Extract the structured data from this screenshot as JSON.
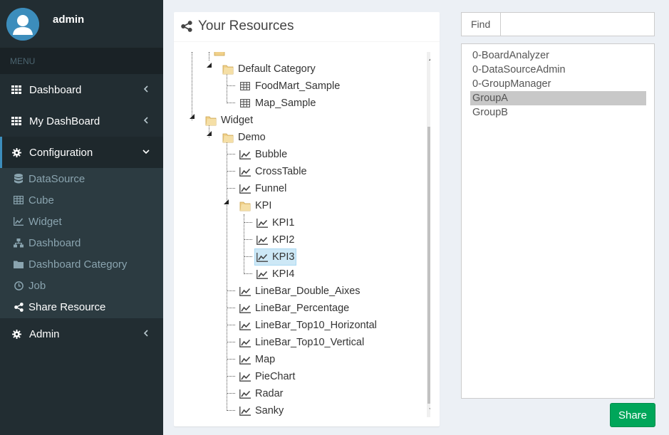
{
  "user": {
    "name": "admin"
  },
  "sidebar": {
    "menu_header": "MENU",
    "items": [
      {
        "label": "Dashboard",
        "icon": "grid-icon"
      },
      {
        "label": "My DashBoard",
        "icon": "grid-icon"
      },
      {
        "label": "Configuration",
        "icon": "gear-icon",
        "expanded": true
      },
      {
        "label": "Admin",
        "icon": "gear-icon"
      }
    ],
    "config_subitems": [
      {
        "label": "DataSource",
        "icon": "database-icon"
      },
      {
        "label": "Cube",
        "icon": "table-icon"
      },
      {
        "label": "Widget",
        "icon": "line-chart-icon"
      },
      {
        "label": "Dashboard",
        "icon": "sitemap-icon"
      },
      {
        "label": "Dashboard Category",
        "icon": "folder-icon"
      },
      {
        "label": "Job",
        "icon": "clock-icon"
      },
      {
        "label": "Share Resource",
        "icon": "share-icon",
        "active": true
      }
    ]
  },
  "panel": {
    "title": "Your Resources"
  },
  "tree": [
    {
      "label": "Default Category",
      "icon": "folder-icon"
    },
    {
      "label": "FoodMart_Sample",
      "icon": "table-icon"
    },
    {
      "label": "Map_Sample",
      "icon": "table-icon"
    },
    {
      "label": "Widget",
      "icon": "folder-icon"
    },
    {
      "label": "Demo",
      "icon": "folder-icon"
    },
    {
      "label": "Bubble",
      "icon": "line-chart-icon"
    },
    {
      "label": "CrossTable",
      "icon": "line-chart-icon"
    },
    {
      "label": "Funnel",
      "icon": "line-chart-icon"
    },
    {
      "label": "KPI",
      "icon": "folder-icon"
    },
    {
      "label": "KPI1",
      "icon": "line-chart-icon"
    },
    {
      "label": "KPI2",
      "icon": "line-chart-icon"
    },
    {
      "label": "KPI3",
      "icon": "line-chart-icon",
      "selected": true
    },
    {
      "label": "KPI4",
      "icon": "line-chart-icon"
    },
    {
      "label": "LineBar_Double_Aixes",
      "icon": "line-chart-icon"
    },
    {
      "label": "LineBar_Percentage",
      "icon": "line-chart-icon"
    },
    {
      "label": "LineBar_Top10_Horizontal",
      "icon": "line-chart-icon"
    },
    {
      "label": "LineBar_Top10_Vertical",
      "icon": "line-chart-icon"
    },
    {
      "label": "Map",
      "icon": "line-chart-icon"
    },
    {
      "label": "PieChart",
      "icon": "line-chart-icon"
    },
    {
      "label": "Radar",
      "icon": "line-chart-icon"
    },
    {
      "label": "Sanky",
      "icon": "line-chart-icon"
    }
  ],
  "find": {
    "label": "Find",
    "value": "",
    "placeholder": ""
  },
  "groups": [
    {
      "label": "0-BoardAnalyzer"
    },
    {
      "label": "0-DataSourceAdmin"
    },
    {
      "label": "0-GroupManager"
    },
    {
      "label": "GroupA",
      "selected": true
    },
    {
      "label": "GroupB"
    }
  ],
  "share_button": "Share",
  "colors": {
    "sidebar": "#222d32",
    "accent": "#3c8dbc",
    "share": "#00a65a",
    "selected_tree": "#cde8f6"
  }
}
